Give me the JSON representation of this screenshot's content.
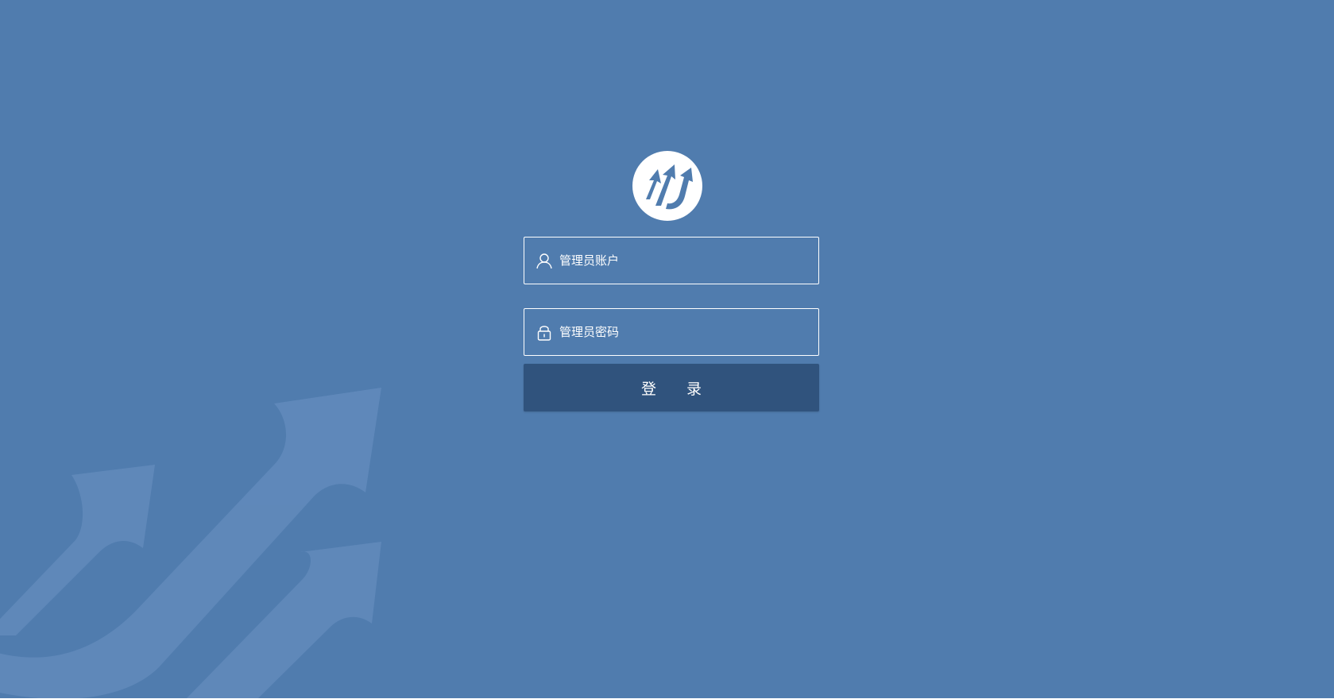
{
  "login": {
    "logo_icon": "rising-arrows-circle-logo",
    "account_field": {
      "icon": "user-icon",
      "placeholder": "管理员账户",
      "value": ""
    },
    "password_field": {
      "icon": "lock-icon",
      "placeholder": "管理员密码",
      "value": ""
    },
    "submit_label": "登 录"
  },
  "colors": {
    "background": "#507cae",
    "button": "#30537d",
    "decoration": "#6089ba",
    "text": "#ffffff"
  }
}
